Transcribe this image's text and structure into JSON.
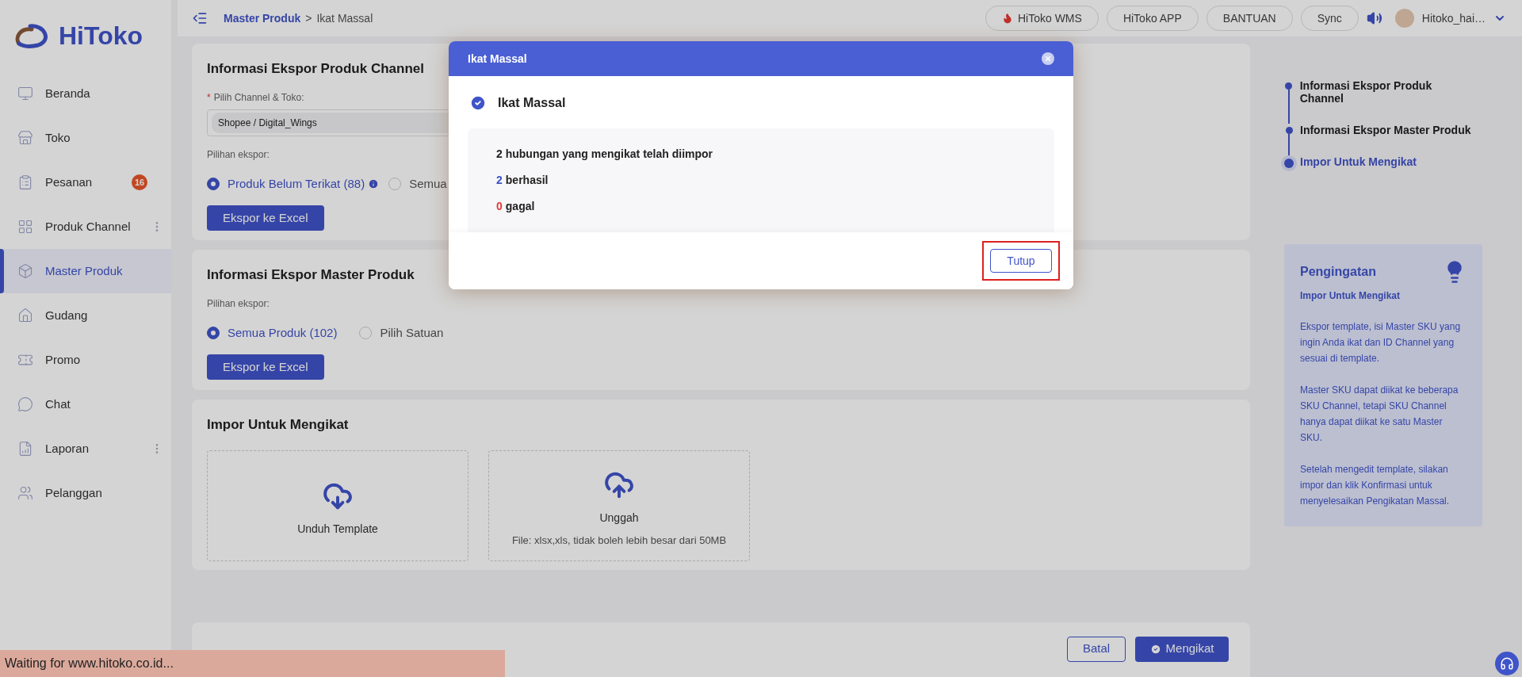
{
  "logo": {
    "text": "HiToko"
  },
  "sidebar": {
    "items": [
      {
        "label": "Beranda",
        "selected": false,
        "more": false
      },
      {
        "label": "Toko",
        "selected": false,
        "more": false
      },
      {
        "label": "Pesanan",
        "selected": false,
        "more": false,
        "badge": "16"
      },
      {
        "label": "Produk Channel",
        "selected": false,
        "more": true
      },
      {
        "label": "Master Produk",
        "selected": true,
        "more": false
      },
      {
        "label": "Gudang",
        "selected": false,
        "more": false
      },
      {
        "label": "Promo",
        "selected": false,
        "more": false
      },
      {
        "label": "Chat",
        "selected": false,
        "more": false
      },
      {
        "label": "Laporan",
        "selected": false,
        "more": true
      },
      {
        "label": "Pelanggan",
        "selected": false,
        "more": false
      }
    ]
  },
  "breadcrumb": {
    "parent": "Master Produk",
    "separator": ">",
    "current": "Ikat Massal"
  },
  "header_buttons": [
    {
      "label": "HiToko WMS",
      "kind": "fire"
    },
    {
      "label": "HiToko APP",
      "kind": "plain"
    },
    {
      "label": "BANTUAN",
      "kind": "plain"
    },
    {
      "label": "Sync",
      "kind": "plain"
    }
  ],
  "user": {
    "name": "Hitoko_hai…"
  },
  "channel_export": {
    "title": "Informasi Ekspor Produk Channel",
    "field_label": "Pilih Channel & Toko:",
    "required_mark": "*",
    "field_value": "Shopee / Digital_Wings",
    "options_label": "Pilihan ekspor:",
    "options": [
      {
        "label": "Produk Belum Terikat (88)",
        "selected": true,
        "info": true
      },
      {
        "label": "Semua",
        "selected": false,
        "info": false
      }
    ],
    "button": "Ekspor ke Excel"
  },
  "master_export": {
    "title": "Informasi Ekspor Master Produk",
    "options_label": "Pilihan ekspor:",
    "options": [
      {
        "label": "Semua Produk (102)",
        "selected": true
      },
      {
        "label": "Pilih Satuan",
        "selected": false
      }
    ],
    "button": "Ekspor ke Excel"
  },
  "import": {
    "title": "Impor Untuk Mengikat",
    "boxes": [
      {
        "kind": "download",
        "label": "Unduh Template"
      },
      {
        "kind": "upload",
        "label": "Unggah",
        "hint": "File: xlsx,xls, tidak boleh lebih besar dari 50MB"
      }
    ]
  },
  "footer_buttons": [
    {
      "label": "Batal",
      "kind": "secondary"
    },
    {
      "label": "Mengikat",
      "kind": "primary"
    }
  ],
  "steps": [
    {
      "label": "Informasi Ekspor Produk Channel",
      "selected": false
    },
    {
      "label": "Informasi Ekspor Master Produk",
      "selected": false
    },
    {
      "label": "Impor Untuk Mengikat",
      "selected": true
    }
  ],
  "reminder": {
    "title": "Pengingatan",
    "subtitle": "Impor Untuk Mengikat",
    "paragraphs": [
      "Ekspor template, isi Master SKU yang ingin Anda ikat dan ID Channel yang sesuai di template.",
      "Master SKU dapat diikat ke beberapa SKU Channel, tetapi SKU Channel hanya dapat diikat ke satu Master SKU.",
      "Setelah mengedit template, silakan impor dan klik Konfirmasi untuk menyelesaikan Pengikatan Massal."
    ]
  },
  "modal": {
    "title": "Ikat Massal",
    "heading": "Ikat Massal",
    "summary": "2 hubungan yang mengikat telah diimpor",
    "results": [
      {
        "count": "2",
        "label": "berhasil",
        "color": "#3f51c4"
      },
      {
        "count": "0",
        "label": "gagal",
        "color": "#e53935"
      }
    ],
    "button": "Tutup",
    "highlighted": true
  },
  "status_bar": {
    "text": "Waiting for www.hitoko.co.id..."
  }
}
